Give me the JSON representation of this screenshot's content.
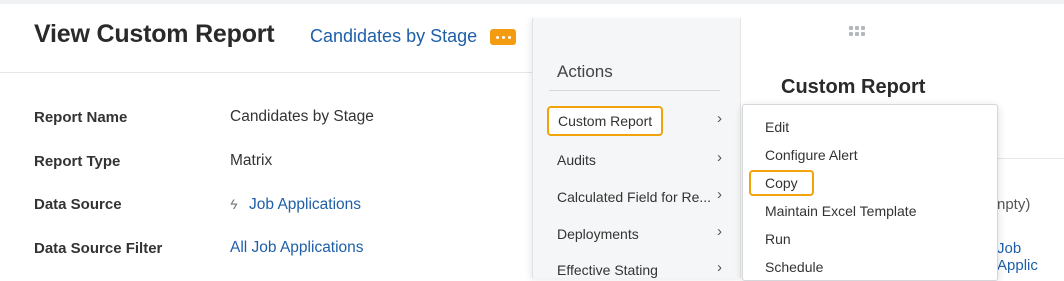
{
  "page": {
    "title": "View Custom Report",
    "report_link": "Candidates by Stage"
  },
  "fields": [
    {
      "label": "Report Name",
      "value": "Candidates by Stage"
    },
    {
      "label": "Report Type",
      "value": "Matrix"
    },
    {
      "label": "Data Source",
      "value": "Job Applications"
    },
    {
      "label": "Data Source Filter",
      "value": "All Job Applications"
    }
  ],
  "actions": {
    "title": "Actions",
    "items": [
      {
        "label": "Custom Report",
        "selected": true
      },
      {
        "label": "Audits"
      },
      {
        "label": "Calculated Field for Re..."
      },
      {
        "label": "Deployments"
      },
      {
        "label": "Effective Stating"
      }
    ]
  },
  "submenu": {
    "items": [
      {
        "label": "Edit"
      },
      {
        "label": "Configure Alert"
      },
      {
        "label": "Copy",
        "selected": true
      },
      {
        "label": "Maintain Excel Template"
      },
      {
        "label": "Run"
      },
      {
        "label": "Schedule"
      }
    ]
  },
  "side_panel": {
    "title": "Custom Report",
    "empty_text": "npty)",
    "link_text": "Job Applic"
  },
  "icons": {
    "chevron": "chevron-right-icon",
    "more": "more-options-icon",
    "grip": "drag-grip-icon",
    "bolt": "lightning-icon"
  },
  "colors": {
    "accent": "#f0a30a",
    "link": "#1e5fa8"
  }
}
